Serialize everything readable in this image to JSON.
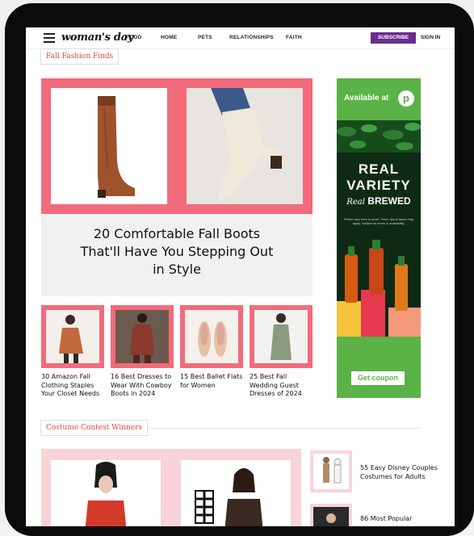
{
  "nav": {
    "logo": "woman's day",
    "items": [
      "FOOD",
      "HOME",
      "PETS",
      "RELATIONSHIPS",
      "FAITH"
    ],
    "subscribe": "SUBSCRIBE",
    "signin": "SIGN IN"
  },
  "section1": {
    "tag": "Fall Fashion Finds"
  },
  "hero": {
    "title_line1": "20 Comfortable Fall Boots",
    "title_line2": "That'll Have You Stepping Out",
    "title_line3": "in Style"
  },
  "cards": [
    {
      "line1": "30 Amazon Fall",
      "line2": "Clothing Staples",
      "line3": "Your Closet Needs"
    },
    {
      "line1": "16 Best Dresses to",
      "line2": "Wear With Cowboy",
      "line3": "Boots in 2024"
    },
    {
      "line1": "15 Best Ballet Flats",
      "line2": "for Women",
      "line3": ""
    },
    {
      "line1": "25 Best Fall",
      "line2": "Wedding Guest",
      "line3": "Dresses of 2024"
    }
  ],
  "ad": {
    "available": "Available at",
    "logo_letter": "p",
    "line1": "REAL",
    "line2": "VARIETY",
    "line3_script": "Real",
    "line3": "BREWED",
    "fine_print": "Prices vary from in-store. Fees, tips & taxes may apply. Subject to terms & availability.",
    "coupon": "Get coupon",
    "brand_color": "#5bb246"
  },
  "section2": {
    "tag": "Costume Contest Winners"
  },
  "side_items": [
    {
      "line1": "55 Easy Disney Couples",
      "line2": "Costumes for Adults"
    },
    {
      "line1": "86 Most Popular",
      "line2": ""
    }
  ],
  "colors": {
    "accent_pink": "#f26b7a",
    "subscribe_purple": "#6a2c91",
    "tag_red": "#e0483e"
  }
}
